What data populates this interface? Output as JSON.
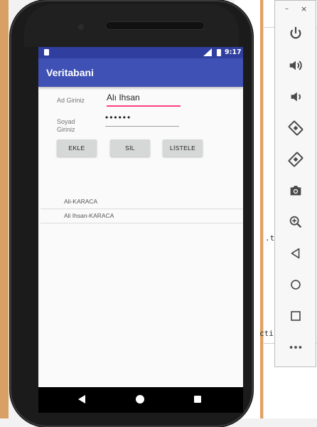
{
  "desktop": {
    "fragment_1": ".t",
    "fragment_2": "cti"
  },
  "status_bar": {
    "time": "9:17"
  },
  "app": {
    "title": "Veritabani"
  },
  "form": {
    "ad_label": "Ad Giriniz",
    "ad_value": "Alı Ihsan",
    "soyad_label": "Soyad Giriniz",
    "soyad_value": "••••••"
  },
  "buttons": {
    "ekle": "EKLE",
    "sil": "SİL",
    "listele": "LİSTELE"
  },
  "list": {
    "items": [
      "Ali-KARACA",
      "Ali Ihsan-KARACA"
    ]
  },
  "emulator": {
    "minimize": "–",
    "close": "×",
    "controls": [
      "power-icon",
      "volume-up-icon",
      "volume-down-icon",
      "rotate-left-icon",
      "rotate-right-icon",
      "camera-icon",
      "zoom-icon",
      "back-icon",
      "home-icon",
      "overview-icon",
      "more-icon"
    ]
  },
  "colors": {
    "primary": "#3f51b5",
    "primary_dark": "#303f9f",
    "accent": "#ff4081"
  }
}
